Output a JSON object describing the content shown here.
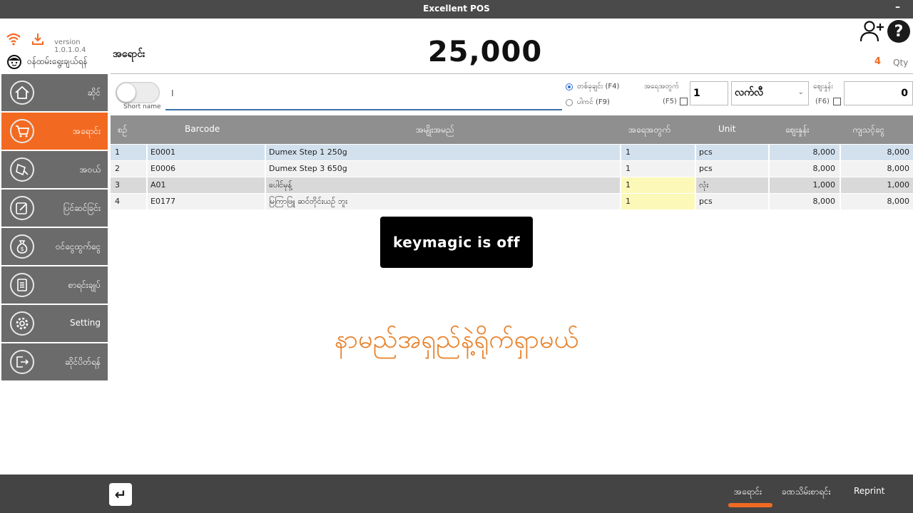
{
  "window": {
    "title": "Excellent POS",
    "minimize": "–"
  },
  "app": {
    "version": "version 1.0.1.0.4",
    "shop_label": "ဝန်ထမ်းရွေးချယ်ရန်"
  },
  "sidebar": {
    "items": [
      {
        "label": "ဆိုင်",
        "icon": "home-icon"
      },
      {
        "label": "အရောင်း",
        "icon": "cart-icon"
      },
      {
        "label": "အဝယ်",
        "icon": "buy-icon"
      },
      {
        "label": "ပြင်ဆင်ခြင်း",
        "icon": "edit-icon"
      },
      {
        "label": "ဝင်ငွေထွက်ငွေ",
        "icon": "money-bag-icon"
      },
      {
        "label": "စာရင်းချုပ်",
        "icon": "report-icon"
      },
      {
        "label": "Setting",
        "icon": "gear-icon"
      },
      {
        "label": "ဆိုင်ပိတ်ရန်",
        "icon": "exit-icon"
      }
    ]
  },
  "header": {
    "label": "အရောင်း",
    "total": "25,000",
    "qty_count": "4",
    "qty_label": "Qty"
  },
  "entry": {
    "toggle_label": "Short name",
    "search_value": "",
    "radio1": "တစ်ခုချင်း (F4)",
    "radio2": "ပါကင် (F9)",
    "qty_label": "အရေအတွက်",
    "qty_key": "(F5)",
    "qty_value": "1",
    "unit_value": "လက်လီ",
    "price_label": "ဈေးနှုန်း",
    "price_key": "(F6)",
    "price_value": "0"
  },
  "table": {
    "headers": [
      "စဉ်",
      "Barcode",
      "အမျိုးအမည်",
      "အရေအတွက်",
      "Unit",
      "ဈေးနှုန်း",
      "ကျသင့်ငွေ"
    ],
    "rows": [
      {
        "no": "1",
        "barcode": "E0001",
        "name": "Dumex Step 1 250g",
        "qty": "1",
        "unit": "pcs",
        "price": "8,000",
        "amount": "8,000"
      },
      {
        "no": "2",
        "barcode": "E0006",
        "name": "Dumex Step 3 650g",
        "qty": "1",
        "unit": "pcs",
        "price": "8,000",
        "amount": "8,000"
      },
      {
        "no": "3",
        "barcode": "A01",
        "name": "ပေါင်မုန့်",
        "qty": "1",
        "unit": "လုံး",
        "price": "1,000",
        "amount": "1,000"
      },
      {
        "no": "4",
        "barcode": "E0177",
        "name": "မြကြာဖြူ ဆင်တိုင်းယဉ် ဘူး",
        "qty": "1",
        "unit": "pcs",
        "price": "8,000",
        "amount": "8,000"
      }
    ]
  },
  "toast": "keymagic  is  off",
  "caption": "နာမည်အရှည်နဲ့ရိုက်ရှာမယ်",
  "bottom": {
    "enter": "↵",
    "tabs": [
      "အရောင်း",
      "ခဏသိမ်းစာရင်း",
      "Reprint"
    ]
  },
  "colors": {
    "accent": "#f26a21",
    "sidebar": "#6b6b6b",
    "bar": "#444444",
    "caption": "#e8822c"
  }
}
